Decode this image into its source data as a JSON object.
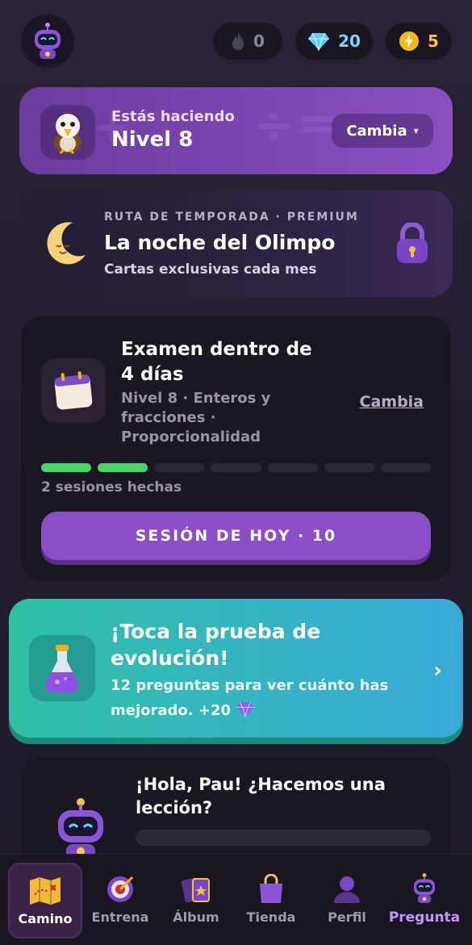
{
  "stats": {
    "streak": "0",
    "gems": "20",
    "energy": "5",
    "streak_icon": "flame-icon",
    "gems_icon": "diamond-icon",
    "energy_icon": "lightning-icon"
  },
  "level_card": {
    "subtitle": "Estás haciendo",
    "title": "Nivel 8",
    "button": "Cambia",
    "button_arrow": "▾"
  },
  "season": {
    "tag": "RUTA DE TEMPORADA · PREMIUM",
    "title": "La noche del Olimpo",
    "description": "Cartas exclusivas cada mes"
  },
  "exam": {
    "title": "Examen dentro de 4 días",
    "meta": "Nivel 8 · Enteros y fracciones · Proporcionalidad",
    "link": "Cambia",
    "sessions_done": 2,
    "sessions_total": 7,
    "sessions_label": "2 sesiones hechas",
    "button": "SESIÓN DE HOY · 10"
  },
  "evolution": {
    "title": "¡Toca la prueba de evolución!",
    "description": "12 preguntas para ver cuánto has mejorado. +20",
    "chevron": "›"
  },
  "greeting": {
    "title": "¡Hola, Pau! ¿Hacemos una lección?"
  },
  "nav": {
    "items": [
      {
        "label": "Camino",
        "icon": "map-icon"
      },
      {
        "label": "Entrena",
        "icon": "target-icon"
      },
      {
        "label": "Álbum",
        "icon": "cards-icon"
      },
      {
        "label": "Tienda",
        "icon": "shopping-bag-icon"
      },
      {
        "label": "Perfil",
        "icon": "user-icon"
      },
      {
        "label": "Pregunta",
        "icon": "robot-icon"
      }
    ],
    "active": "Camino"
  },
  "colors": {
    "accent_purple": "#8a4fc6",
    "progress_green": "#4cd46a",
    "evolution_teal": "#2fc0a6"
  }
}
